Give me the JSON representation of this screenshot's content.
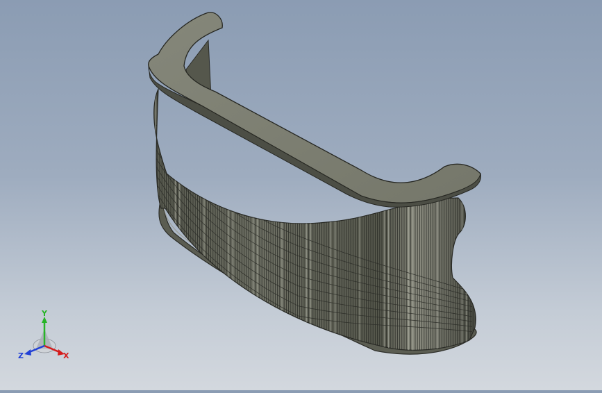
{
  "viewport": {
    "model": "curved-slat-counter",
    "colors": {
      "background_top": "#8b9cb3",
      "background_bottom": "#d3d8de",
      "body": "#6c6e62",
      "body_dark": "#3f413a",
      "top_face": "#7f8173",
      "slat_line": "#1f201c",
      "highlight": "#c9cabf"
    }
  },
  "triad": {
    "x_label": "X",
    "y_label": "Y",
    "z_label": "Z",
    "colors": {
      "x": "#d41c1c",
      "y": "#27b427",
      "z": "#2140d6"
    }
  }
}
